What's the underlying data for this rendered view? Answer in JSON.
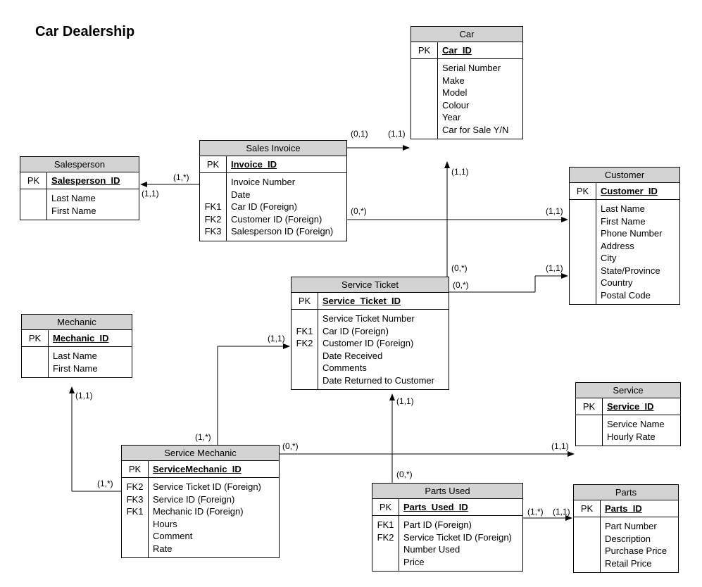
{
  "title": "Car Dealership",
  "entities": {
    "salesperson": {
      "name": "Salesperson",
      "pk_label": "PK",
      "pk": "Salesperson_ID",
      "attrs": [
        "Last Name",
        "First Name"
      ]
    },
    "sales_invoice": {
      "name": "Sales Invoice",
      "pk_label": "PK",
      "pk": "Invoice_ID",
      "fk_labels": [
        "",
        "",
        "FK1",
        "FK2",
        "FK3"
      ],
      "attrs": [
        "Invoice Number",
        "Date",
        "Car ID (Foreign)",
        "Customer ID (Foreign)",
        "Salesperson ID (Foreign)"
      ]
    },
    "car": {
      "name": "Car",
      "pk_label": "PK",
      "pk": "Car_ID",
      "attrs": [
        "Serial Number",
        "Make",
        "Model",
        "Colour",
        "Year",
        "Car for Sale Y/N"
      ]
    },
    "customer": {
      "name": "Customer",
      "pk_label": "PK",
      "pk": "Customer_ID",
      "attrs": [
        "Last Name",
        "First Name",
        "Phone Number",
        "Address",
        "City",
        "State/Province",
        "Country",
        "Postal Code"
      ]
    },
    "mechanic": {
      "name": "Mechanic",
      "pk_label": "PK",
      "pk": "Mechanic_ID",
      "attrs": [
        "Last Name",
        "First Name"
      ]
    },
    "service_ticket": {
      "name": "Service Ticket",
      "pk_label": "PK",
      "pk": "Service_Ticket_ID",
      "fk_labels": [
        "",
        "FK1",
        "FK2",
        "",
        "",
        ""
      ],
      "attrs": [
        "Service Ticket Number",
        "Car ID (Foreign)",
        "Customer ID (Foreign)",
        "Date Received",
        "Comments",
        "Date Returned to Customer"
      ]
    },
    "service": {
      "name": "Service",
      "pk_label": "PK",
      "pk": "Service_ID",
      "attrs": [
        "Service Name",
        "Hourly Rate"
      ]
    },
    "service_mechanic": {
      "name": "Service Mechanic",
      "pk_label": "PK",
      "pk": "ServiceMechanic_ID",
      "fk_labels": [
        "FK2",
        "FK3",
        "FK1",
        "",
        "",
        ""
      ],
      "attrs": [
        "Service Ticket ID (Foreign)",
        "Service ID (Foreign)",
        "Mechanic ID (Foreign)",
        "Hours",
        "Comment",
        "Rate"
      ]
    },
    "parts_used": {
      "name": "Parts Used",
      "pk_label": "PK",
      "pk": "Parts_Used_ID",
      "fk_labels": [
        "FK1",
        "FK2",
        "",
        ""
      ],
      "attrs": [
        "Part ID (Foreign)",
        "Service Ticket ID (Foreign)",
        "Number Used",
        "Price"
      ]
    },
    "parts": {
      "name": "Parts",
      "pk_label": "PK",
      "pk": "Parts_ID",
      "attrs": [
        "Part Number",
        "Description",
        "Purchase Price",
        "Retail Price"
      ]
    }
  },
  "cards": {
    "c1": "(0,1)",
    "c2": "(1,1)",
    "c3": "(1,*)",
    "c4": "(1,1)",
    "c5": "(0,*)",
    "c6": "(1,1)",
    "c7": "(1,1)",
    "c8": "(0,*)",
    "c9": "(0,*)",
    "c10": "(1,1)",
    "c11": "(1,1)",
    "c12": "(1,*)",
    "c13": "(0,*)",
    "c14": "(1,1)",
    "c15": "(1,1)",
    "c16": "(1,*)",
    "c17": "(0,*)",
    "c18": "(1,1)",
    "c19": "(1,*)",
    "c20": "(1,1)"
  }
}
